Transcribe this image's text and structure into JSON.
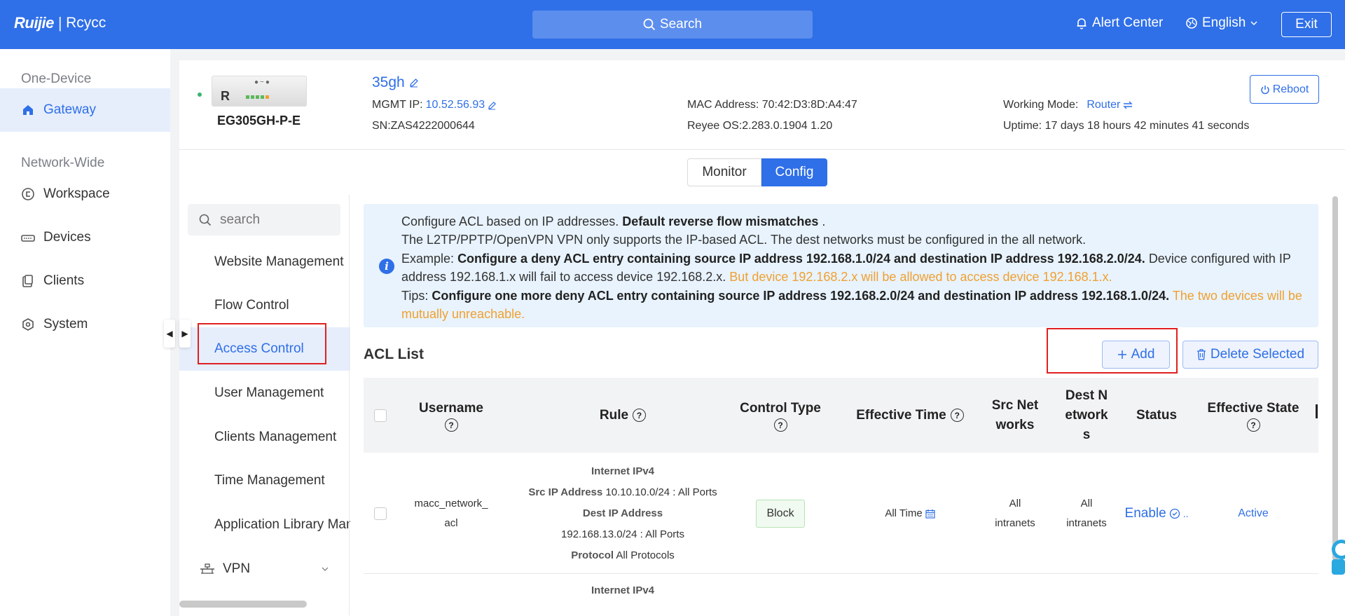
{
  "topbar": {
    "logo_brand": "Ruijie",
    "logo_sep": "|",
    "logo_sub": "Rcycc",
    "search_label": "Search",
    "alert_label": "Alert Center",
    "language_label": "English",
    "exit_label": "Exit"
  },
  "sidebar": {
    "section_one": "One-Device",
    "gateway": "Gateway",
    "section_network": "Network-Wide",
    "items": [
      {
        "label": "Workspace",
        "icon": "workspace-icon"
      },
      {
        "label": "Devices",
        "icon": "devices-icon"
      },
      {
        "label": "Clients",
        "icon": "clients-icon"
      },
      {
        "label": "System",
        "icon": "system-icon"
      }
    ]
  },
  "device": {
    "image_label": "R",
    "model": "EG305GH-P-E",
    "name": "35gh",
    "mgmt_ip_label": "MGMT IP:",
    "mgmt_ip": "10.52.56.93",
    "sn": "SN:ZAS4222000644",
    "mac": "MAC Address: 70:42:D3:8D:A4:47",
    "os": "Reyee OS:2.283.0.1904 1.20",
    "mode_label": "Working Mode:",
    "mode_value": "Router",
    "uptime": "Uptime: 17 days 18 hours 42 minutes 41 seconds",
    "reboot_label": "Reboot"
  },
  "tabs": {
    "monitor": "Monitor",
    "config": "Config"
  },
  "submenu": {
    "search_placeholder": "search",
    "items": [
      "Website Management",
      "Flow Control",
      "Access Control",
      "User Management",
      "Clients Management",
      "Time Management",
      "Application Library Management"
    ],
    "vpn": "VPN"
  },
  "info": {
    "line1_text": "Configure ACL based on IP addresses.",
    "line1_bold": "Default reverse flow mismatches",
    "line1_end": ".",
    "line2": "The L2TP/PPTP/OpenVPN VPN only supports the IP-based ACL. The dest networks must be configured in the all network.",
    "ex_label": "Example:",
    "ex_bold": "Configure a deny ACL entry containing source IP address 192.168.1.0/24 and destination IP address 192.168.2.0/24.",
    "ex_text": "Device configured with IP address 192.168.1.x will fail to access device 192.168.2.x.",
    "ex_warn": "But device 192.168.2.x will be allowed to access device 192.168.1.x.",
    "tips_label": "Tips:",
    "tips_bold": "Configure one more deny ACL entry containing source IP address 192.168.2.0/24 and destination IP address 192.168.1.0/24.",
    "tips_warn": "The two devices will be mutually unreachable."
  },
  "acl": {
    "title": "ACL List",
    "add_label": "Add",
    "delete_label": "Delete Selected",
    "headers": {
      "username": "Username",
      "rule": "Rule",
      "control_type": "Control Type",
      "effective_time": "Effective Time",
      "src_networks": "Src Networks",
      "dest_networks": "Dest Networks",
      "status": "Status",
      "effective_state": "Effective State"
    },
    "rows": [
      {
        "username": "macc_network_acl",
        "rule_type": "Internet IPv4",
        "src_label": "Src IP Address",
        "src_value": "10.10.10.0/24 : All Ports",
        "dest_label": "Dest IP Address",
        "dest_value": "192.168.13.0/24 : All Ports",
        "proto_label": "Protocol",
        "proto_value": "All Protocols",
        "control_type": "Block",
        "effective_time": "All Time",
        "src_networks": "All intranets",
        "dest_networks": "All intranets",
        "status": "Enable",
        "effective_state": "Active"
      },
      {
        "rule_type": "Internet IPv4"
      }
    ]
  },
  "colors": {
    "primary": "#2f6fe8",
    "warning": "#f0a030",
    "highlight_box": "#e02020"
  }
}
